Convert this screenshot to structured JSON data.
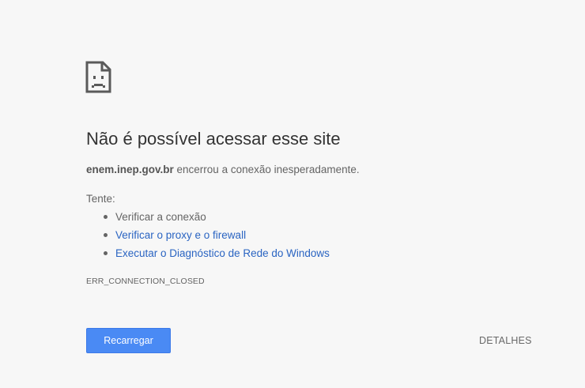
{
  "page": {
    "icon": "sad-page-icon",
    "title": "Não é possível acessar esse site",
    "description": {
      "host": "enem.inep.gov.br",
      "message": " encerrou a conexão inesperadamente."
    },
    "try_label": "Tente:",
    "suggestions": [
      {
        "text": "Verificar a conexão",
        "link": false
      },
      {
        "text": "Verificar o proxy e o firewall",
        "link": true
      },
      {
        "text": "Executar o Diagnóstico de Rede do Windows",
        "link": true
      }
    ],
    "error_code": "ERR_CONNECTION_CLOSED",
    "reload_label": "Recarregar",
    "details_label": "DETALHES"
  },
  "colors": {
    "background": "#f7f7f7",
    "link": "#2a64c2",
    "button": "#4a8af4",
    "text": "#646464",
    "title": "#333333"
  }
}
